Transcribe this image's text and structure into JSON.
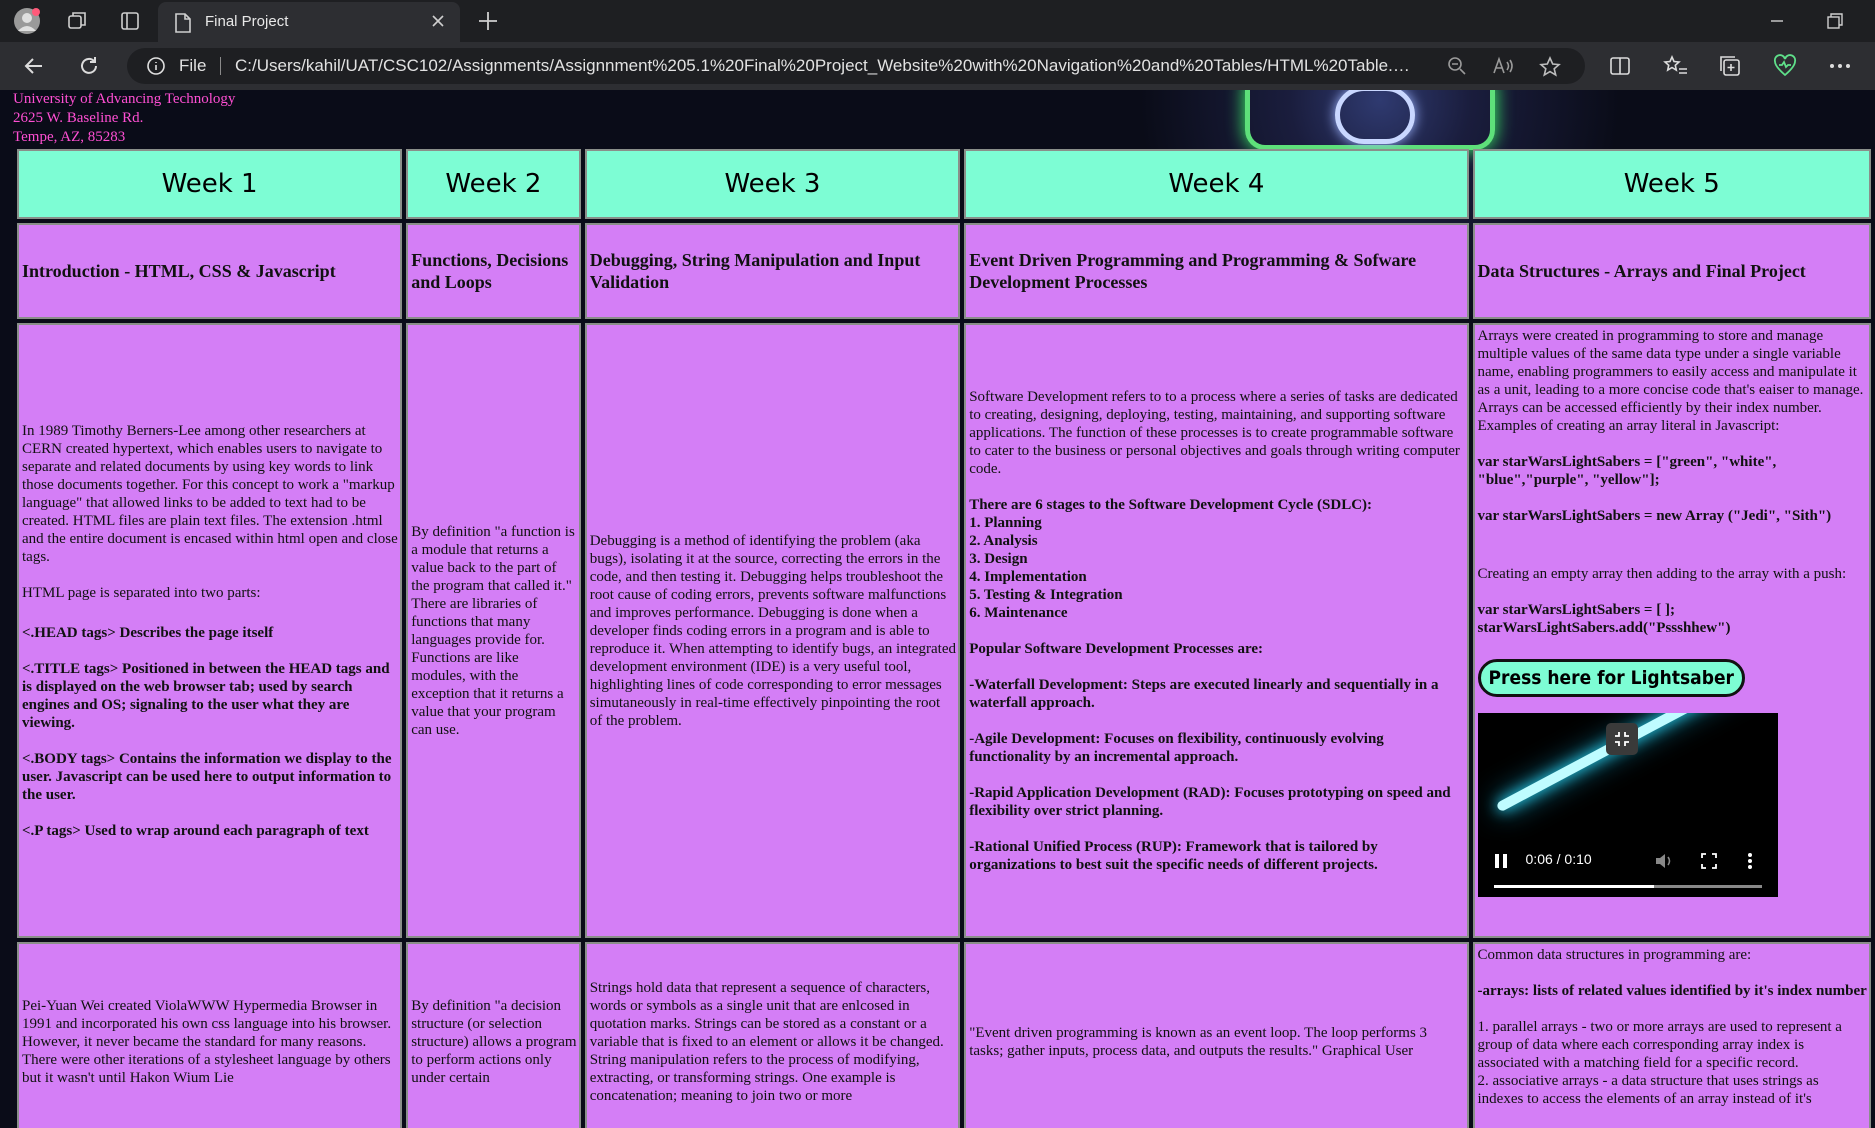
{
  "browser": {
    "tab_title": "Final Project",
    "file_label": "File",
    "url": "C:/Users/kahil/UAT/CSC102/Assignments/Assignnment%205.1%20Final%20Project_Website%20with%20Navigation%20and%20Tables/HTML%20Table.h..."
  },
  "address": {
    "line1": "University of Advancing Technology",
    "line2": "2625 W. Baseline Rd.",
    "line3": "Tempe, AZ, 85283"
  },
  "weeks": [
    {
      "title": "Week 1",
      "topic": "Introduction - HTML, CSS & Javascript"
    },
    {
      "title": "Week 2",
      "topic": "Functions, Decisions and Loops"
    },
    {
      "title": "Week 3",
      "topic": "Debugging, String Manipulation and Input Validation"
    },
    {
      "title": "Week 4",
      "topic": "Event Driven Programming and Programming & Sofware Development Processes"
    },
    {
      "title": "Week 5",
      "topic": "Data Structures - Arrays and Final Project"
    }
  ],
  "w1": {
    "p1": "In 1989 Timothy Berners-Lee among other researchers at CERN created hypertext, which enables users to navigate to separate and related documents by using key words to link those documents together. For this concept to work a \"markup language\" that allowed links to be added to text had to be created. HTML files are plain text files. The extension .html and the entire document is encased within html open and close tags.",
    "p2": "HTML page is separated into two parts:",
    "p3": "<.HEAD tags> Describes the page itself",
    "p4": "<.TITLE tags> Positioned in between the HEAD tags and is displayed on the web browser tab; used by search engines and OS; signaling to the user what they are viewing.",
    "p5": "<.BODY tags> Contains the information we display to the user. Javascript can be used here to output information to the user.",
    "p6": "<.P tags> Used to wrap around each paragraph of text"
  },
  "w2": {
    "p1": "By definition \"a function is a module that returns a value back to the part of the program that called it.\" There are libraries of functions that many languages provide for. Functions are like modules, with the exception that it returns a value that your program can use."
  },
  "w3": {
    "p1": "Debugging is a method of identifying the problem (aka bugs), isolating it at the source, correcting the errors in the code, and then testing it. Debugging helps troubleshoot the root cause of coding errors, prevents software malfunctions and improves performance. Debugging is done when a developer finds coding errors in a program and is able to reproduce it. When attempting to identify bugs, an integrated development environment (IDE) is a very useful tool, highlighting lines of code corresponding to error messages simutaneously in real-time effectively pinpointing the root of the problem."
  },
  "w4": {
    "p1": "Software Development refers to to a process where a series of tasks are dedicated to creating, designing, deploying, testing, maintaining, and supporting software applications. The function of these processes is to create programmable software to cater to the business or personal objectives and goals through writing computer code.",
    "sdlc_heading": "There are 6 stages to the Software Development Cycle (SDLC):",
    "sdlc": [
      "1. Planning",
      "2. Analysis",
      "3. Design",
      "4. Implementation",
      "5. Testing & Integration",
      "6. Maintenance"
    ],
    "processes_heading": "Popular Software Development Processes are:",
    "proc1": "-Waterfall Development: Steps are executed linearly and sequentially in a waterfall approach.",
    "proc2": "-Agile Development: Focuses on flexibility, continuously evolving functionality by an incremental approach.",
    "proc3": "-Rapid Application Development (RAD): Focuses prototyping on speed and flexibility over strict planning.",
    "proc4": "-Rational Unified Process (RUP): Framework that is tailored by organizations to best suit the specific needs of different projects."
  },
  "w5": {
    "p1": "Arrays were created in programming to store and manage multiple values of the same data type under a single variable name, enabling programmers to easily access and manipulate it as a unit, leading to a more concise code that's eaiser to manage. Arrays can be accessed efficiently by their index number. Examples of creating an array literal in Javascript:",
    "code1": "var starWarsLightSabers = [\"green\", \"white\", \"blue\",\"purple\", \"yellow\"];",
    "code2": "var starWarsLightSabers = new Array (\"Jedi\", \"Sith\")",
    "p2": "Creating an empty array then adding to the array with a push:",
    "code3a": "var starWarsLightSabers = [ ];",
    "code3b": "starWarsLightSabers.add(\"Pssshhew\")",
    "button": "Press here for Lightsaber",
    "video_time": "0:06 / 0:10",
    "video_progress": 0.6
  },
  "row2": {
    "w1": "Pei-Yuan Wei created ViolaWWW Hypermedia Browser in 1991 and incorporated his own css language into his browser. However, it never became the standard for many reasons. There were other iterations of a stylesheet language by others but it wasn't until Hakon Wium Lie",
    "w2": "By definition \"a decision structure (or selection structure) allows a program to perform actions only under certain",
    "w3": "Strings hold data that represent a sequence of characters, words or symbols as a single unit that are enlcosed in quotation marks. Strings can be stored as a constant or a variable that is fixed to an element or allows it be changed. String manipulation refers to the process of modifying, extracting, or transforming strings. One example is concatenation; meaning to join two or more",
    "w4": "\"Event driven programming is known as an event loop. The loop performs 3 tasks; gather inputs, process data, and outputs the results.\" Graphical User",
    "w5_p1": "Common data structures in programming are:",
    "w5_p2": "-arrays: lists of related values identified by it's index number",
    "w5_p3": "1. parallel arrays - two or more arrays are used to represent a group of data where each corresponding array index is associated with a matching field for a specific record.",
    "w5_p4": "2. associative arrays - a data structure that uses strings as indexes to access the elements of an array instead of it's"
  }
}
